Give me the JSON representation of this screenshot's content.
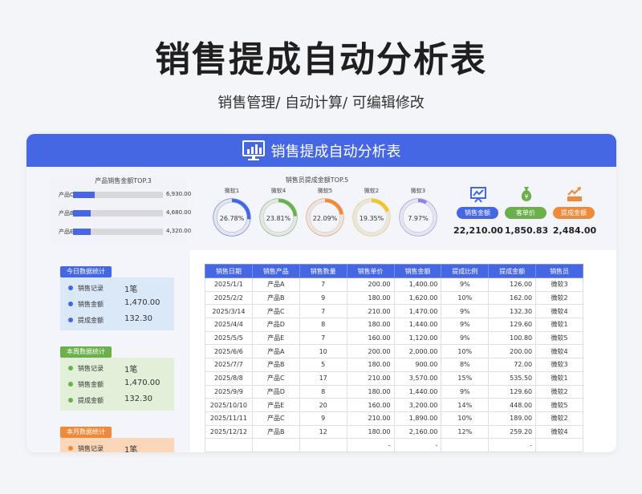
{
  "page": {
    "title": "销售提成自动分析表",
    "subtitle": "销售管理/ 自动计算/ 可编辑修改"
  },
  "card": {
    "header_title": "销售提成自动分析表"
  },
  "top3": {
    "title": "产品销售金额TOP.3",
    "items": [
      {
        "label": "产品C",
        "value": "6,930.00",
        "ratio": 0.24
      },
      {
        "label": "产品B",
        "value": "4,680.00",
        "ratio": 0.2
      },
      {
        "label": "产品E",
        "value": "4,320.00",
        "ratio": 0.2
      }
    ]
  },
  "top5": {
    "title": "销售员提成金额TOP.5",
    "items": [
      {
        "name": "微软1",
        "pct": "26.78%",
        "ratio": 0.2678,
        "color": "#4567e4"
      },
      {
        "name": "微软4",
        "pct": "23.81%",
        "ratio": 0.2381,
        "color": "#6bb04b"
      },
      {
        "name": "微软5",
        "pct": "22.09%",
        "ratio": 0.2209,
        "color": "#ee8a3a"
      },
      {
        "name": "微软2",
        "pct": "19.35%",
        "ratio": 0.1935,
        "color": "#f2c32a"
      },
      {
        "name": "微软3",
        "pct": "7.97%",
        "ratio": 0.0797,
        "color": "#8d7ef0"
      }
    ]
  },
  "kpis": [
    {
      "icon": "chart-board-icon",
      "label": "销售金额",
      "value": "22,210.00",
      "color": "#4567e4"
    },
    {
      "icon": "money-bag-icon",
      "label": "客单价",
      "value": "1,850.83",
      "color": "#6bb04b"
    },
    {
      "icon": "commission-growth-icon",
      "label": "提成金额",
      "value": "2,484.00",
      "color": "#ee8a3a"
    }
  ],
  "stats": [
    {
      "tag": "今日数据统计",
      "color": "#4567e4",
      "bg": "#dbe8f8",
      "rows": [
        {
          "label": "销售记录",
          "value": "1笔"
        },
        {
          "label": "销售金额",
          "value": "1,470.00"
        },
        {
          "label": "提成金额",
          "value": "132.30"
        }
      ]
    },
    {
      "tag": "本周数据统计",
      "color": "#6bb04b",
      "bg": "#e2f0d9",
      "rows": [
        {
          "label": "销售记录",
          "value": "1笔"
        },
        {
          "label": "销售金额",
          "value": "1,470.00"
        },
        {
          "label": "提成金额",
          "value": "132.30"
        }
      ]
    },
    {
      "tag": "本月数据统计",
      "color": "#ee8a3a",
      "bg": "#fbd6b8",
      "rows": [
        {
          "label": "销售记录",
          "value": "1笔"
        }
      ]
    }
  ],
  "table": {
    "headers": [
      "销售日期",
      "销售产品",
      "销售数量",
      "销售单价",
      "销售金额",
      "提成比例",
      "提成金额",
      "销售员"
    ],
    "rows": [
      [
        "2025/1/1",
        "产品A",
        "7",
        "200.00",
        "1,400.00",
        "9%",
        "126.00",
        "微软3"
      ],
      [
        "2025/2/2",
        "产品B",
        "9",
        "180.00",
        "1,620.00",
        "10%",
        "162.00",
        "微软2"
      ],
      [
        "2025/3/14",
        "产品C",
        "7",
        "210.00",
        "1,470.00",
        "9%",
        "132.30",
        "微软4"
      ],
      [
        "2025/4/4",
        "产品D",
        "8",
        "180.00",
        "1,440.00",
        "9%",
        "129.60",
        "微软1"
      ],
      [
        "2025/5/5",
        "产品E",
        "7",
        "160.00",
        "1,120.00",
        "9%",
        "100.80",
        "微软5"
      ],
      [
        "2025/6/6",
        "产品A",
        "10",
        "200.00",
        "2,000.00",
        "10%",
        "200.00",
        "微软4"
      ],
      [
        "2025/7/7",
        "产品B",
        "5",
        "180.00",
        "900.00",
        "8%",
        "72.00",
        "微软3"
      ],
      [
        "2025/8/8",
        "产品C",
        "17",
        "210.00",
        "3,570.00",
        "15%",
        "535.50",
        "微软1"
      ],
      [
        "2025/9/9",
        "产品D",
        "8",
        "180.00",
        "1,440.00",
        "9%",
        "129.60",
        "微软2"
      ],
      [
        "2025/10/10",
        "产品E",
        "20",
        "160.00",
        "3,200.00",
        "14%",
        "448.00",
        "微软5"
      ],
      [
        "2025/11/11",
        "产品C",
        "9",
        "210.00",
        "1,890.00",
        "10%",
        "189.00",
        "微软2"
      ],
      [
        "2025/12/12",
        "产品B",
        "12",
        "180.00",
        "2,160.00",
        "12%",
        "259.20",
        "微软4"
      ],
      [
        "",
        "",
        "",
        "-",
        "-",
        "",
        "-",
        ""
      ]
    ]
  }
}
